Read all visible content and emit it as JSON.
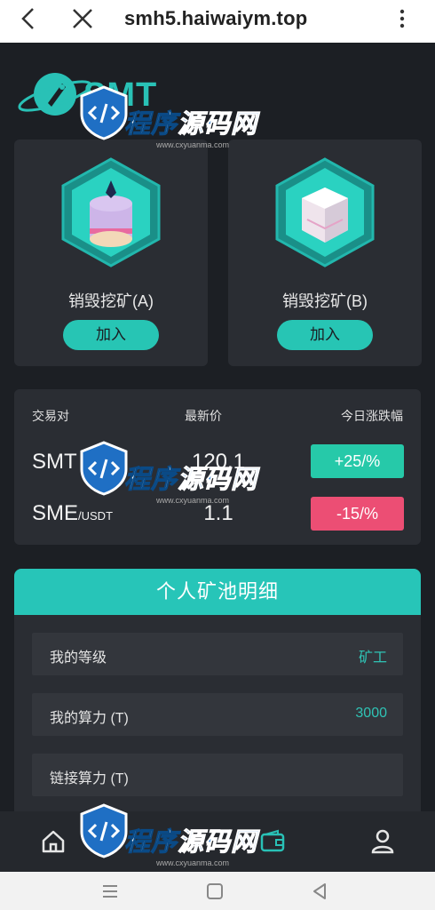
{
  "browser": {
    "url": "smh5.haiwaiym.top"
  },
  "brand": {
    "name": "SMT"
  },
  "mining": [
    {
      "label": "销毁挖矿(A)",
      "button": "加入"
    },
    {
      "label": "销毁挖矿(B)",
      "button": "加入"
    }
  ],
  "market": {
    "headers": [
      "交易对",
      "最新价",
      "今日涨跌幅"
    ],
    "rows": [
      {
        "pair": "SMT",
        "quote": "",
        "price": "120.1",
        "change": "+25/%"
      },
      {
        "pair": "SME",
        "quote": "/USDT",
        "price": "1.1",
        "change": "-15/%"
      }
    ]
  },
  "pool": {
    "title": "个人矿池明细",
    "rows": [
      {
        "key": "我的等级",
        "value": "矿工"
      },
      {
        "key": "我的算力 (T)",
        "value": "3000"
      },
      {
        "key": "链接算力 (T)",
        "value": ""
      }
    ]
  },
  "watermark": {
    "brand_1": "程序",
    "brand_2": "源码网",
    "url": "www.cxyuanma.com"
  },
  "colors": {
    "accent": "#27c5b8",
    "up": "#26c9a9",
    "down": "#ec4e74",
    "background": "#1c1f24",
    "card": "#2a2d33"
  },
  "icons": [
    "back-arrow-icon",
    "close-icon",
    "more-vertical-icon",
    "home-icon",
    "wallet-icon",
    "user-icon",
    "menu-icon",
    "square-icon",
    "triangle-back-icon"
  ]
}
